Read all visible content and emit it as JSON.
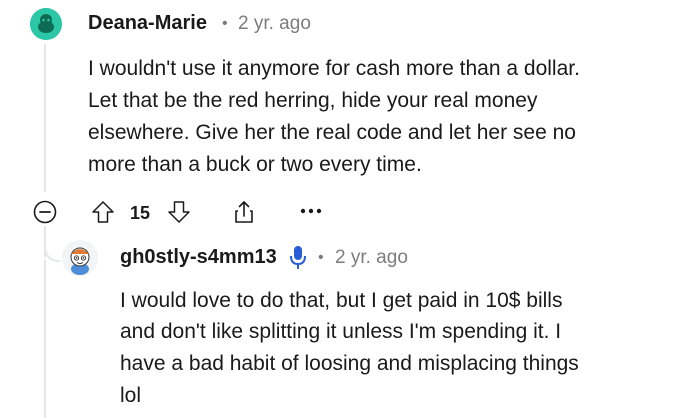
{
  "comment": {
    "username": "Deana-Marie",
    "separator": "•",
    "timestamp": "2 yr. ago",
    "body_lines": [
      "I wouldn't use it anymore for cash more than a dollar.",
      "Let that be the red herring, hide your real money",
      "elsewhere. Give her the real code and let her see no",
      "more than a buck or two every time."
    ],
    "vote_count": "15",
    "more_label": "•••",
    "colors": {
      "avatar_bg": "#2bc7a6",
      "avatar_fg": "#0c6b52"
    }
  },
  "reply": {
    "username": "gh0stly-s4mm13",
    "separator": "•",
    "timestamp": "2 yr. ago",
    "badge_icon": "microphone-icon",
    "body_lines": [
      "I would love to do that, but I get paid in 10$ bills",
      "and don't like splitting it unless I'm spending it. I",
      "have a bad habit of loosing and misplacing things",
      "lol"
    ],
    "colors": {
      "badge": "#2a5ed6",
      "avatar_bg": "#f2f4f5"
    }
  },
  "icons": {
    "collapse": "collapse-minus-icon",
    "upvote": "upvote-arrow-icon",
    "downvote": "downvote-arrow-icon",
    "share": "share-icon",
    "more": "more-options-icon"
  }
}
